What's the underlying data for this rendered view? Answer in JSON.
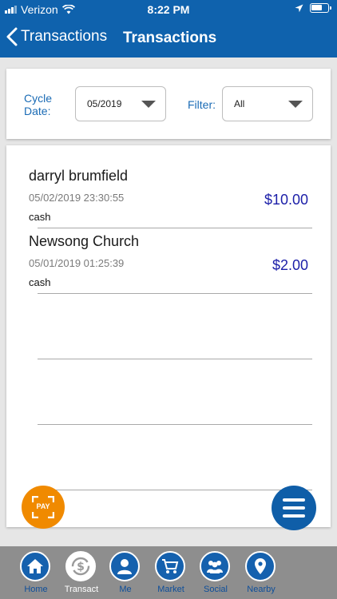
{
  "status": {
    "carrier": "Verizon",
    "time": "8:22 PM"
  },
  "nav": {
    "back_label": "Transactions",
    "title": "Transactions"
  },
  "filters": {
    "cycle_label_1": "Cycle",
    "cycle_label_2": "Date:",
    "cycle_value": "05/2019",
    "filter_label": "Filter:",
    "filter_value": "All"
  },
  "transactions": [
    {
      "name": "darryl brumfield",
      "datetime": "05/02/2019 23:30:55",
      "method": "cash",
      "amount": "$10.00"
    },
    {
      "name": "Newsong Church",
      "datetime": "05/01/2019 01:25:39",
      "method": "cash",
      "amount": "$2.00"
    }
  ],
  "pay_button": {
    "label": "PAY"
  },
  "tabs": [
    {
      "label": "Home",
      "icon": "home-icon"
    },
    {
      "label": "Transact",
      "icon": "dollar-refresh-icon",
      "active": true
    },
    {
      "label": "Me",
      "icon": "person-icon"
    },
    {
      "label": "Market",
      "icon": "cart-icon"
    },
    {
      "label": "Social",
      "icon": "group-icon"
    },
    {
      "label": "Nearby",
      "icon": "location-pin-icon"
    }
  ],
  "colors": {
    "header": "#0f62ad",
    "amount": "#1b1ea8",
    "pay": "#f08a00",
    "tabbar": "#8e8e8e"
  }
}
